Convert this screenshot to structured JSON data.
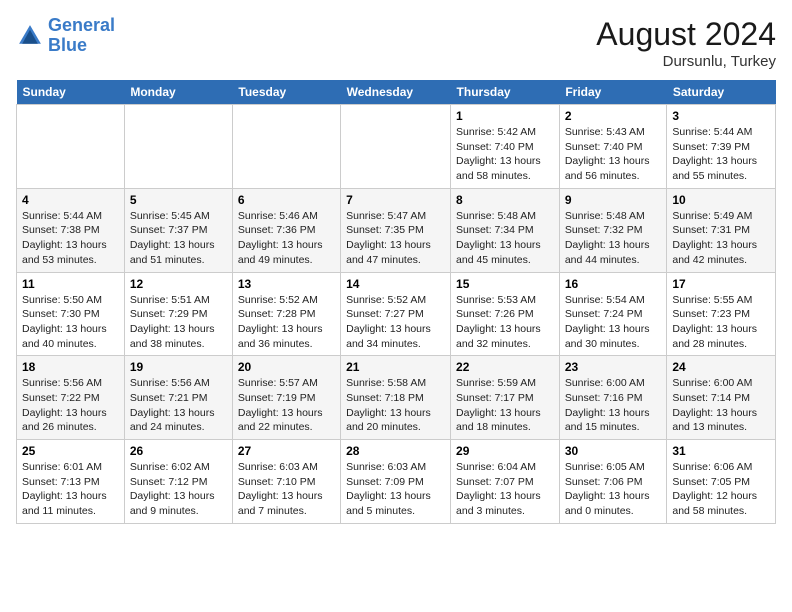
{
  "header": {
    "logo_line1": "General",
    "logo_line2": "Blue",
    "month_year": "August 2024",
    "location": "Dursunlu, Turkey"
  },
  "weekdays": [
    "Sunday",
    "Monday",
    "Tuesday",
    "Wednesday",
    "Thursday",
    "Friday",
    "Saturday"
  ],
  "weeks": [
    [
      {
        "day": "",
        "info": ""
      },
      {
        "day": "",
        "info": ""
      },
      {
        "day": "",
        "info": ""
      },
      {
        "day": "",
        "info": ""
      },
      {
        "day": "1",
        "info": "Sunrise: 5:42 AM\nSunset: 7:40 PM\nDaylight: 13 hours and 58 minutes."
      },
      {
        "day": "2",
        "info": "Sunrise: 5:43 AM\nSunset: 7:40 PM\nDaylight: 13 hours and 56 minutes."
      },
      {
        "day": "3",
        "info": "Sunrise: 5:44 AM\nSunset: 7:39 PM\nDaylight: 13 hours and 55 minutes."
      }
    ],
    [
      {
        "day": "4",
        "info": "Sunrise: 5:44 AM\nSunset: 7:38 PM\nDaylight: 13 hours and 53 minutes."
      },
      {
        "day": "5",
        "info": "Sunrise: 5:45 AM\nSunset: 7:37 PM\nDaylight: 13 hours and 51 minutes."
      },
      {
        "day": "6",
        "info": "Sunrise: 5:46 AM\nSunset: 7:36 PM\nDaylight: 13 hours and 49 minutes."
      },
      {
        "day": "7",
        "info": "Sunrise: 5:47 AM\nSunset: 7:35 PM\nDaylight: 13 hours and 47 minutes."
      },
      {
        "day": "8",
        "info": "Sunrise: 5:48 AM\nSunset: 7:34 PM\nDaylight: 13 hours and 45 minutes."
      },
      {
        "day": "9",
        "info": "Sunrise: 5:48 AM\nSunset: 7:32 PM\nDaylight: 13 hours and 44 minutes."
      },
      {
        "day": "10",
        "info": "Sunrise: 5:49 AM\nSunset: 7:31 PM\nDaylight: 13 hours and 42 minutes."
      }
    ],
    [
      {
        "day": "11",
        "info": "Sunrise: 5:50 AM\nSunset: 7:30 PM\nDaylight: 13 hours and 40 minutes."
      },
      {
        "day": "12",
        "info": "Sunrise: 5:51 AM\nSunset: 7:29 PM\nDaylight: 13 hours and 38 minutes."
      },
      {
        "day": "13",
        "info": "Sunrise: 5:52 AM\nSunset: 7:28 PM\nDaylight: 13 hours and 36 minutes."
      },
      {
        "day": "14",
        "info": "Sunrise: 5:52 AM\nSunset: 7:27 PM\nDaylight: 13 hours and 34 minutes."
      },
      {
        "day": "15",
        "info": "Sunrise: 5:53 AM\nSunset: 7:26 PM\nDaylight: 13 hours and 32 minutes."
      },
      {
        "day": "16",
        "info": "Sunrise: 5:54 AM\nSunset: 7:24 PM\nDaylight: 13 hours and 30 minutes."
      },
      {
        "day": "17",
        "info": "Sunrise: 5:55 AM\nSunset: 7:23 PM\nDaylight: 13 hours and 28 minutes."
      }
    ],
    [
      {
        "day": "18",
        "info": "Sunrise: 5:56 AM\nSunset: 7:22 PM\nDaylight: 13 hours and 26 minutes."
      },
      {
        "day": "19",
        "info": "Sunrise: 5:56 AM\nSunset: 7:21 PM\nDaylight: 13 hours and 24 minutes."
      },
      {
        "day": "20",
        "info": "Sunrise: 5:57 AM\nSunset: 7:19 PM\nDaylight: 13 hours and 22 minutes."
      },
      {
        "day": "21",
        "info": "Sunrise: 5:58 AM\nSunset: 7:18 PM\nDaylight: 13 hours and 20 minutes."
      },
      {
        "day": "22",
        "info": "Sunrise: 5:59 AM\nSunset: 7:17 PM\nDaylight: 13 hours and 18 minutes."
      },
      {
        "day": "23",
        "info": "Sunrise: 6:00 AM\nSunset: 7:16 PM\nDaylight: 13 hours and 15 minutes."
      },
      {
        "day": "24",
        "info": "Sunrise: 6:00 AM\nSunset: 7:14 PM\nDaylight: 13 hours and 13 minutes."
      }
    ],
    [
      {
        "day": "25",
        "info": "Sunrise: 6:01 AM\nSunset: 7:13 PM\nDaylight: 13 hours and 11 minutes."
      },
      {
        "day": "26",
        "info": "Sunrise: 6:02 AM\nSunset: 7:12 PM\nDaylight: 13 hours and 9 minutes."
      },
      {
        "day": "27",
        "info": "Sunrise: 6:03 AM\nSunset: 7:10 PM\nDaylight: 13 hours and 7 minutes."
      },
      {
        "day": "28",
        "info": "Sunrise: 6:03 AM\nSunset: 7:09 PM\nDaylight: 13 hours and 5 minutes."
      },
      {
        "day": "29",
        "info": "Sunrise: 6:04 AM\nSunset: 7:07 PM\nDaylight: 13 hours and 3 minutes."
      },
      {
        "day": "30",
        "info": "Sunrise: 6:05 AM\nSunset: 7:06 PM\nDaylight: 13 hours and 0 minutes."
      },
      {
        "day": "31",
        "info": "Sunrise: 6:06 AM\nSunset: 7:05 PM\nDaylight: 12 hours and 58 minutes."
      }
    ]
  ]
}
